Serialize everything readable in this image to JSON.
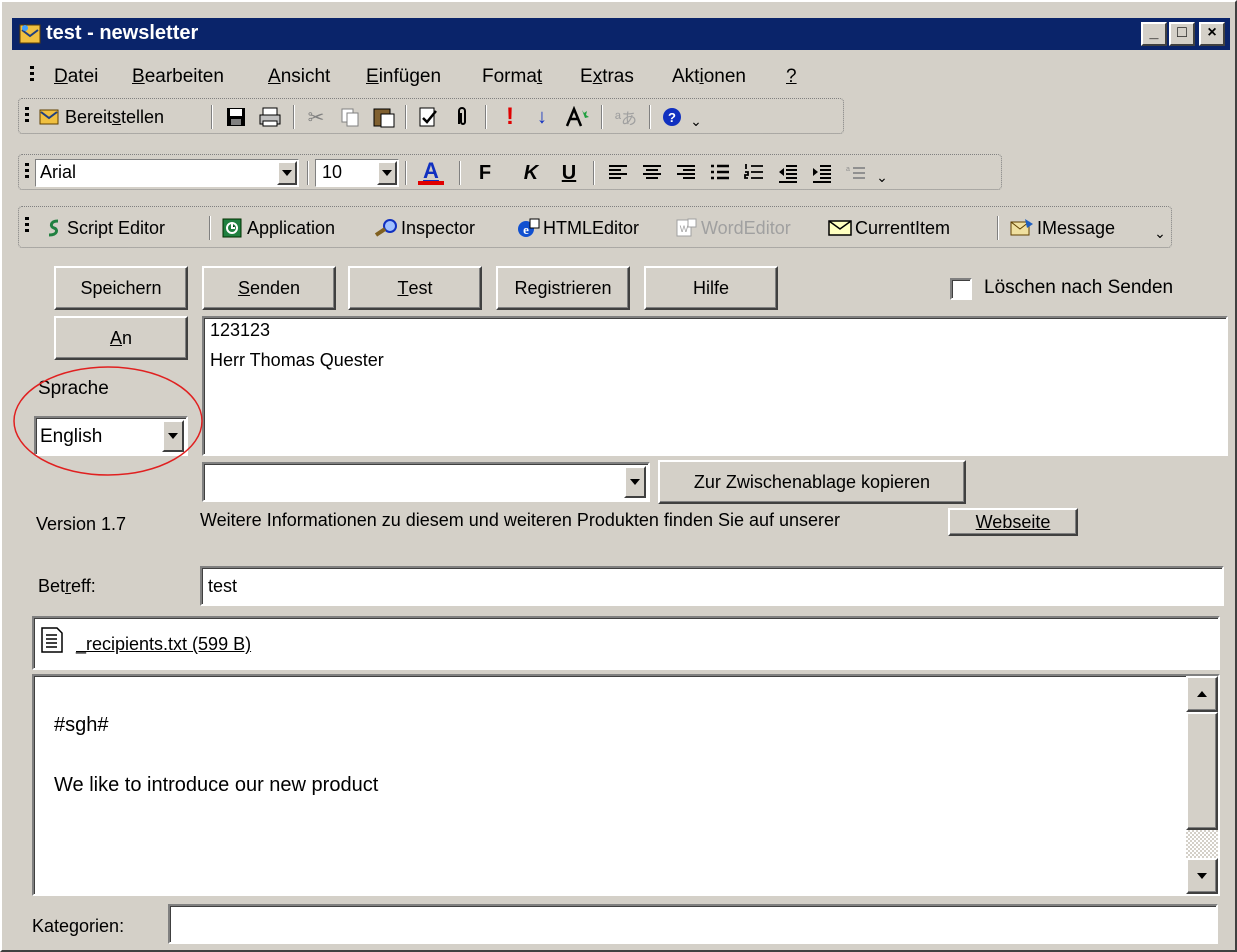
{
  "window": {
    "title": "test - newsletter",
    "controls": [
      "_",
      "□",
      "×"
    ]
  },
  "menu": [
    {
      "pre": "",
      "acc": "D",
      "post": "atei"
    },
    {
      "pre": "",
      "acc": "B",
      "post": "earbeiten"
    },
    {
      "pre": "",
      "acc": "A",
      "post": "nsicht"
    },
    {
      "pre": "",
      "acc": "E",
      "post": "infügen"
    },
    {
      "pre": "Forma",
      "acc": "t",
      "post": ""
    },
    {
      "pre": "E",
      "acc": "x",
      "post": "tras"
    },
    {
      "pre": "Akt",
      "acc": "i",
      "post": "onen"
    },
    {
      "pre": "",
      "acc": "?",
      "post": ""
    }
  ],
  "toolbar1": {
    "distribute_pre": "Bereit",
    "distribute_acc": "s",
    "distribute_post": "tellen",
    "overflow": "⌄"
  },
  "toolbar2": {
    "font": "Arial",
    "size": "10",
    "bold": "F",
    "italic": "K",
    "underline": "U",
    "overflow": "⌄"
  },
  "toolbar3": {
    "script_editor": "Script Editor",
    "application": "Application",
    "inspector": "Inspector",
    "html_editor": "HTMLEditor",
    "word_editor": "WordEditor",
    "current_item": "CurrentItem",
    "imessage": "IMessage",
    "overflow": "⌄"
  },
  "buttons": {
    "save": "Speichern",
    "send_acc": "S",
    "send_rest": "enden",
    "test_acc": "T",
    "test_rest": "est",
    "register": "Registrieren",
    "help": "Hilfe",
    "to_acc": "A",
    "to_rest": "n",
    "copy_clipboard": "Zur Zwischenablage kopieren",
    "website": "Webseite"
  },
  "delete_after_send": {
    "label": "Löschen nach Senden",
    "checked": false
  },
  "recipients": [
    "123123",
    "Herr Thomas Quester"
  ],
  "language": {
    "label": "Sprache",
    "value": "English"
  },
  "version": "Version 1.7",
  "info_text": "Weitere Informationen zu diesem und weiteren Produkten finden Sie auf unserer",
  "subject": {
    "label_pre": "Bet",
    "label_acc": "r",
    "label_post": "eff:",
    "value": "test"
  },
  "attachment": {
    "name": "_recipients.txt (599 B)"
  },
  "message_body": [
    "#sgh#",
    "We like to introduce our new product"
  ],
  "categories": {
    "label_pre": "Kate",
    "label_acc": "g",
    "label_post": "orien:",
    "value": ""
  },
  "colors": {
    "titlebar": "#0a246a",
    "face": "#d4d0c8",
    "highlight_circle": "#e02020"
  }
}
